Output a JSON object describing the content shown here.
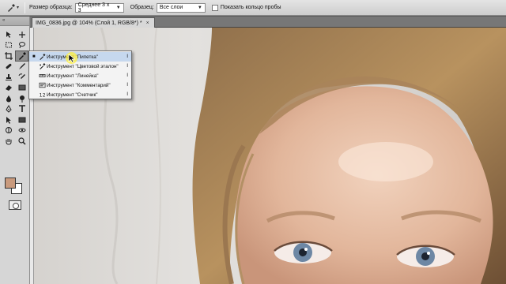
{
  "options_bar": {
    "tool_icon": "eyedropper-icon",
    "sample_size_label": "Размер образца:",
    "sample_size_value": "Среднее 3 х 3",
    "sample_label": "Образец:",
    "sample_value": "Все слои",
    "show_ring_label": "Показать кольцо пробы",
    "show_ring_checked": false
  },
  "tools_panel": {
    "header": "«"
  },
  "colors": {
    "foreground": "#c99a7d",
    "background": "#ffffff",
    "selection_highlight": "#c6d8ee"
  },
  "document": {
    "tab_title": "IMG_0836.jpg @ 104% (Слой 1, RGB/8*) *",
    "close_glyph": "×"
  },
  "flyout_menu": {
    "items": [
      {
        "label": "Инструмент \"Пипетка\"",
        "shortcut": "I",
        "selected": true,
        "icon": "eyedropper-icon"
      },
      {
        "label": "Инструмент \"Цветовой эталон\"",
        "shortcut": "I",
        "selected": false,
        "icon": "color-sampler-icon"
      },
      {
        "label": "Инструмент \"Линейка\"",
        "shortcut": "I",
        "selected": false,
        "icon": "ruler-icon"
      },
      {
        "label": "Инструмент \"Комментарий\"",
        "shortcut": "I",
        "selected": false,
        "icon": "note-icon"
      },
      {
        "label": "Инструмент \"Счетчик\"",
        "shortcut": "I",
        "selected": false,
        "icon": "count-icon"
      }
    ]
  }
}
